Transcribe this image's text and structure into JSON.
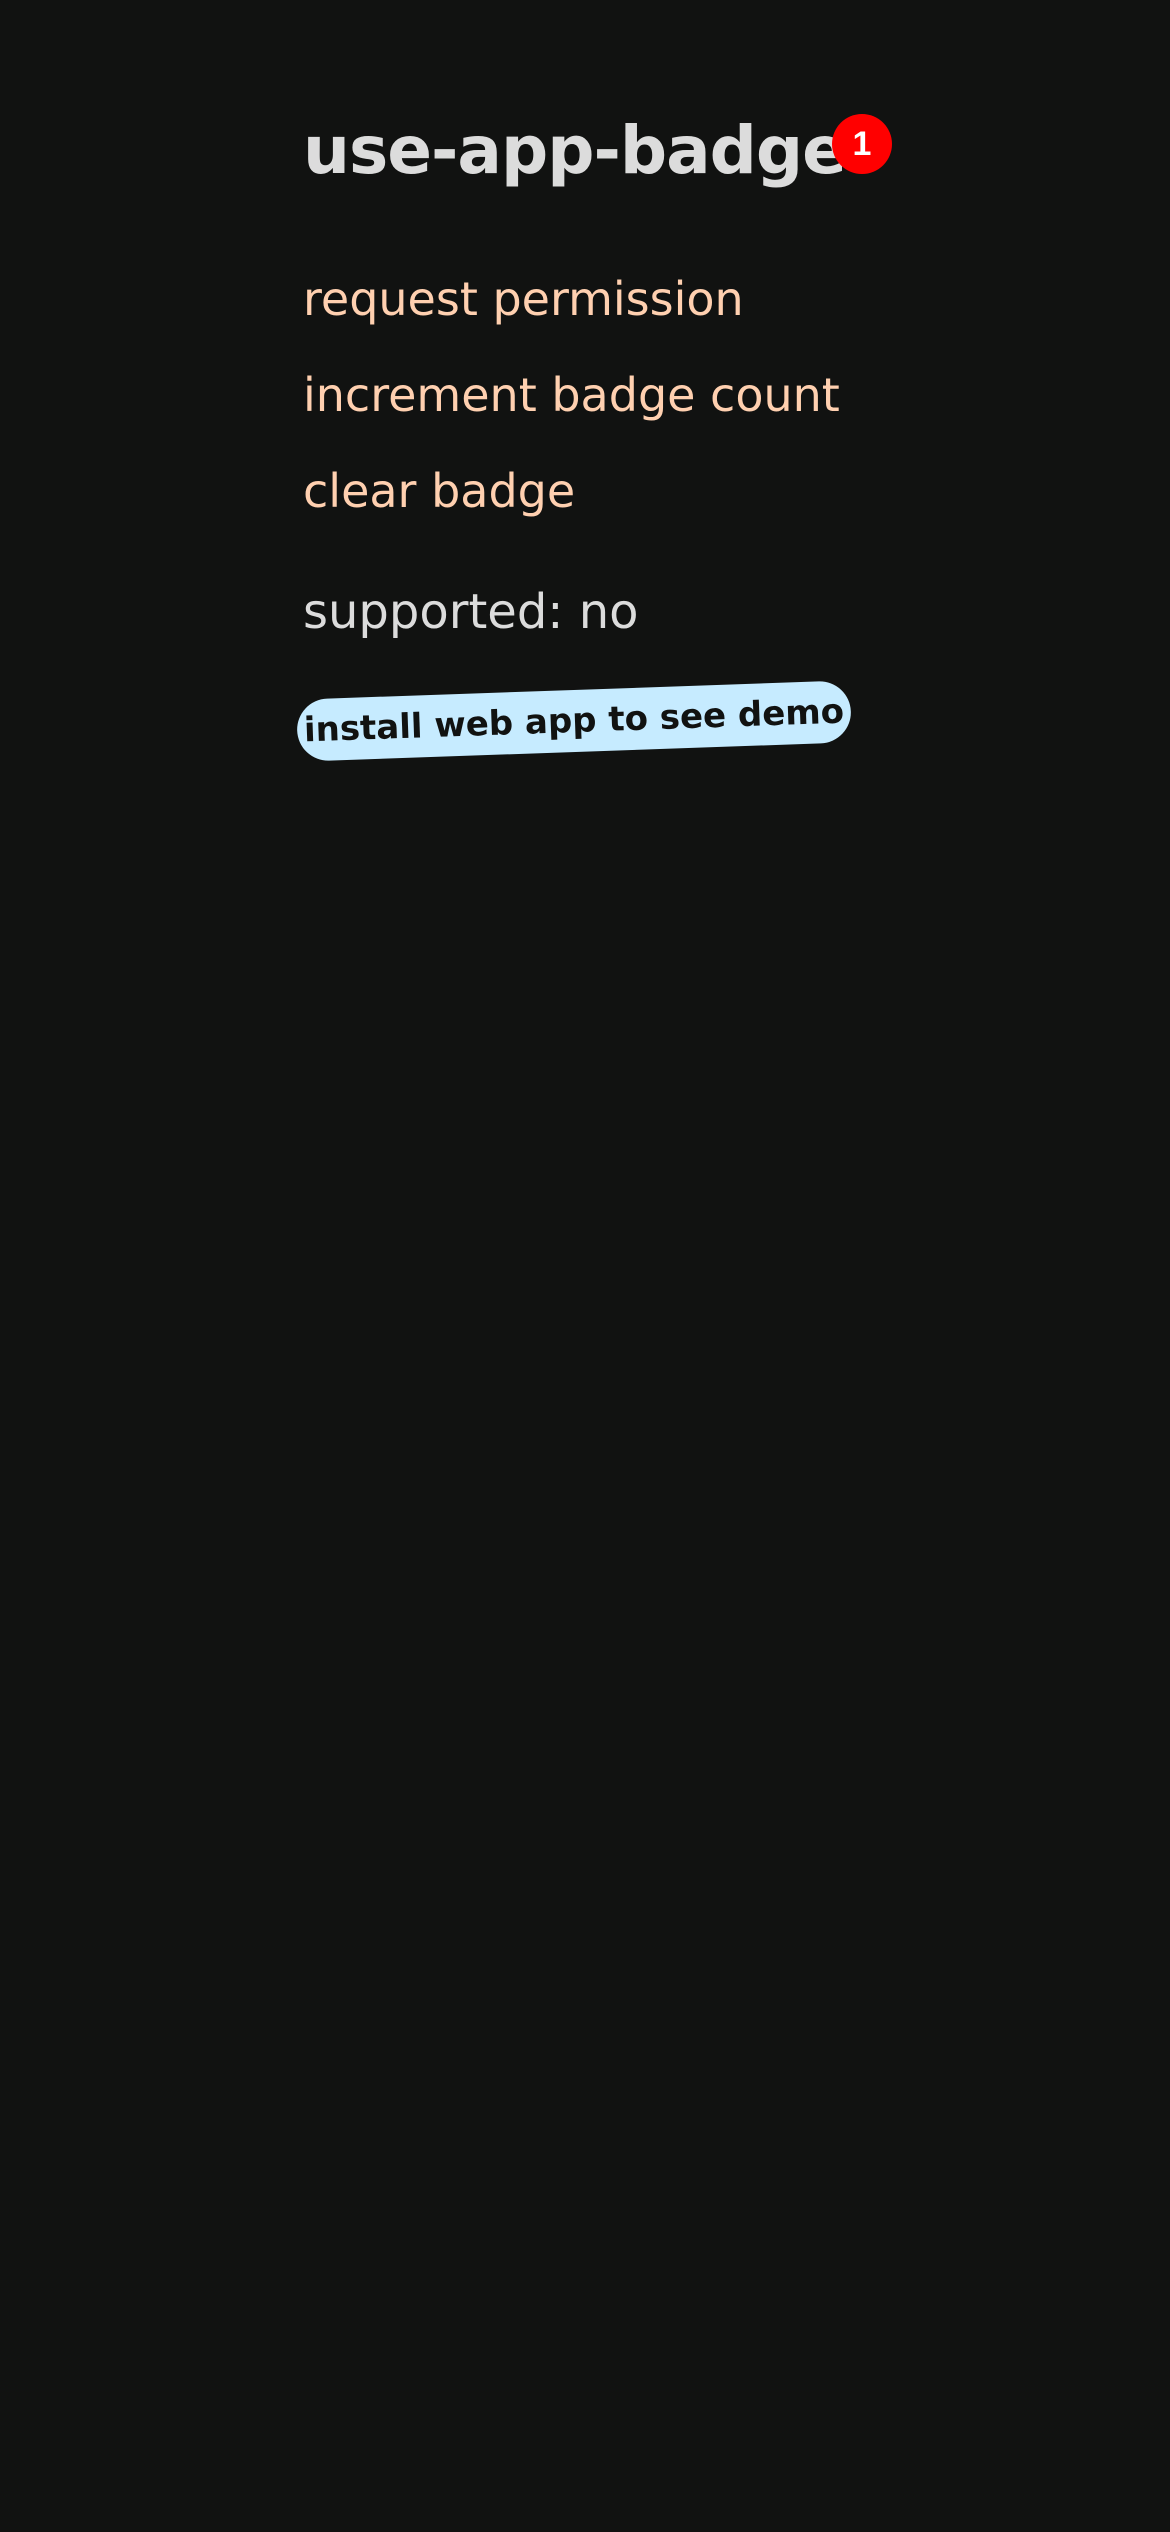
{
  "header": {
    "title": "use-app-badge",
    "badge_count": "1"
  },
  "actions": {
    "request_permission": "request permission",
    "increment_badge_count": "increment badge count",
    "clear_badge": "clear badge"
  },
  "status": {
    "supported_text": "supported: no"
  },
  "notice": {
    "install_text": "install web app to see demo"
  },
  "colors": {
    "background": "#111211",
    "title": "#dcdcdc",
    "link": "#ffd0b0",
    "badge": "#ff0000",
    "pill": "#c6ebff"
  }
}
